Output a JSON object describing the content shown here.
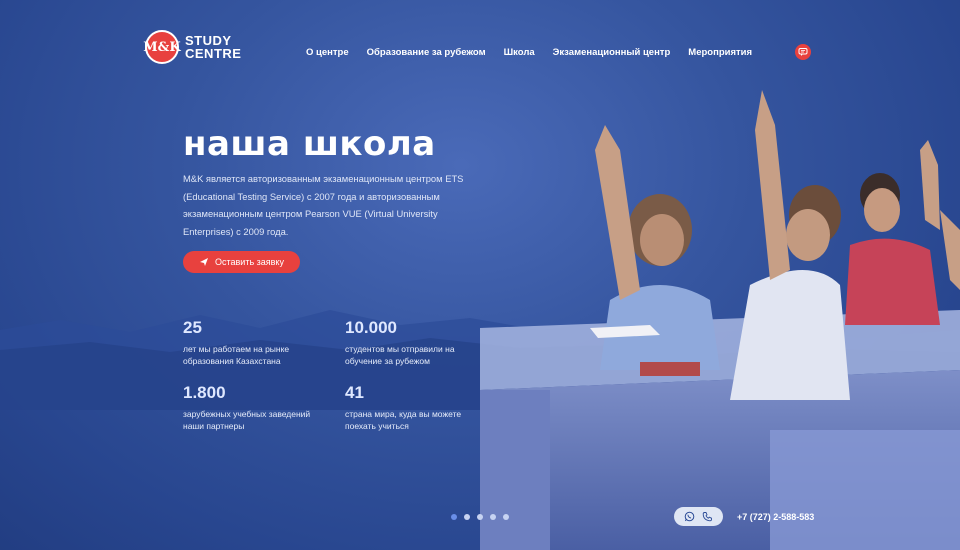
{
  "logo": {
    "mark": "M&K",
    "line1": "STUDY",
    "line2": "CENTRE"
  },
  "nav": [
    {
      "label": "О центре"
    },
    {
      "label": "Образование за рубежом"
    },
    {
      "label": "Школа"
    },
    {
      "label": "Экзаменационный центр"
    },
    {
      "label": "Мероприятия"
    }
  ],
  "hero": {
    "title": "наша школа",
    "description": "M&K является авторизованным экзаменационным центром ETS (Educational Testing Service) с 2007 года и авторизованным экзаменационным центром Pearson VUE (Virtual University Enterprises) с 2009 года.",
    "cta_label": "Оставить заявку"
  },
  "stats": [
    {
      "value": "25",
      "label": "лет мы работаем на рынке образования Казахстана"
    },
    {
      "value": "10.000",
      "label": "студентов мы отправили на обучение за рубежом"
    },
    {
      "value": "1.800",
      "label": "зарубежных учебных заведений наши партнеры"
    },
    {
      "value": "41",
      "label": "страна мира, куда вы можете поехать учиться"
    }
  ],
  "slider": {
    "count": 5,
    "active_index": 0
  },
  "contacts": {
    "phone": "+7 (727) 2-588-583"
  },
  "colors": {
    "accent": "#e8413e",
    "background": "#2a4a96"
  },
  "icons": [
    "chat-icon",
    "send-icon",
    "whatsapp-icon",
    "phone-icon"
  ]
}
